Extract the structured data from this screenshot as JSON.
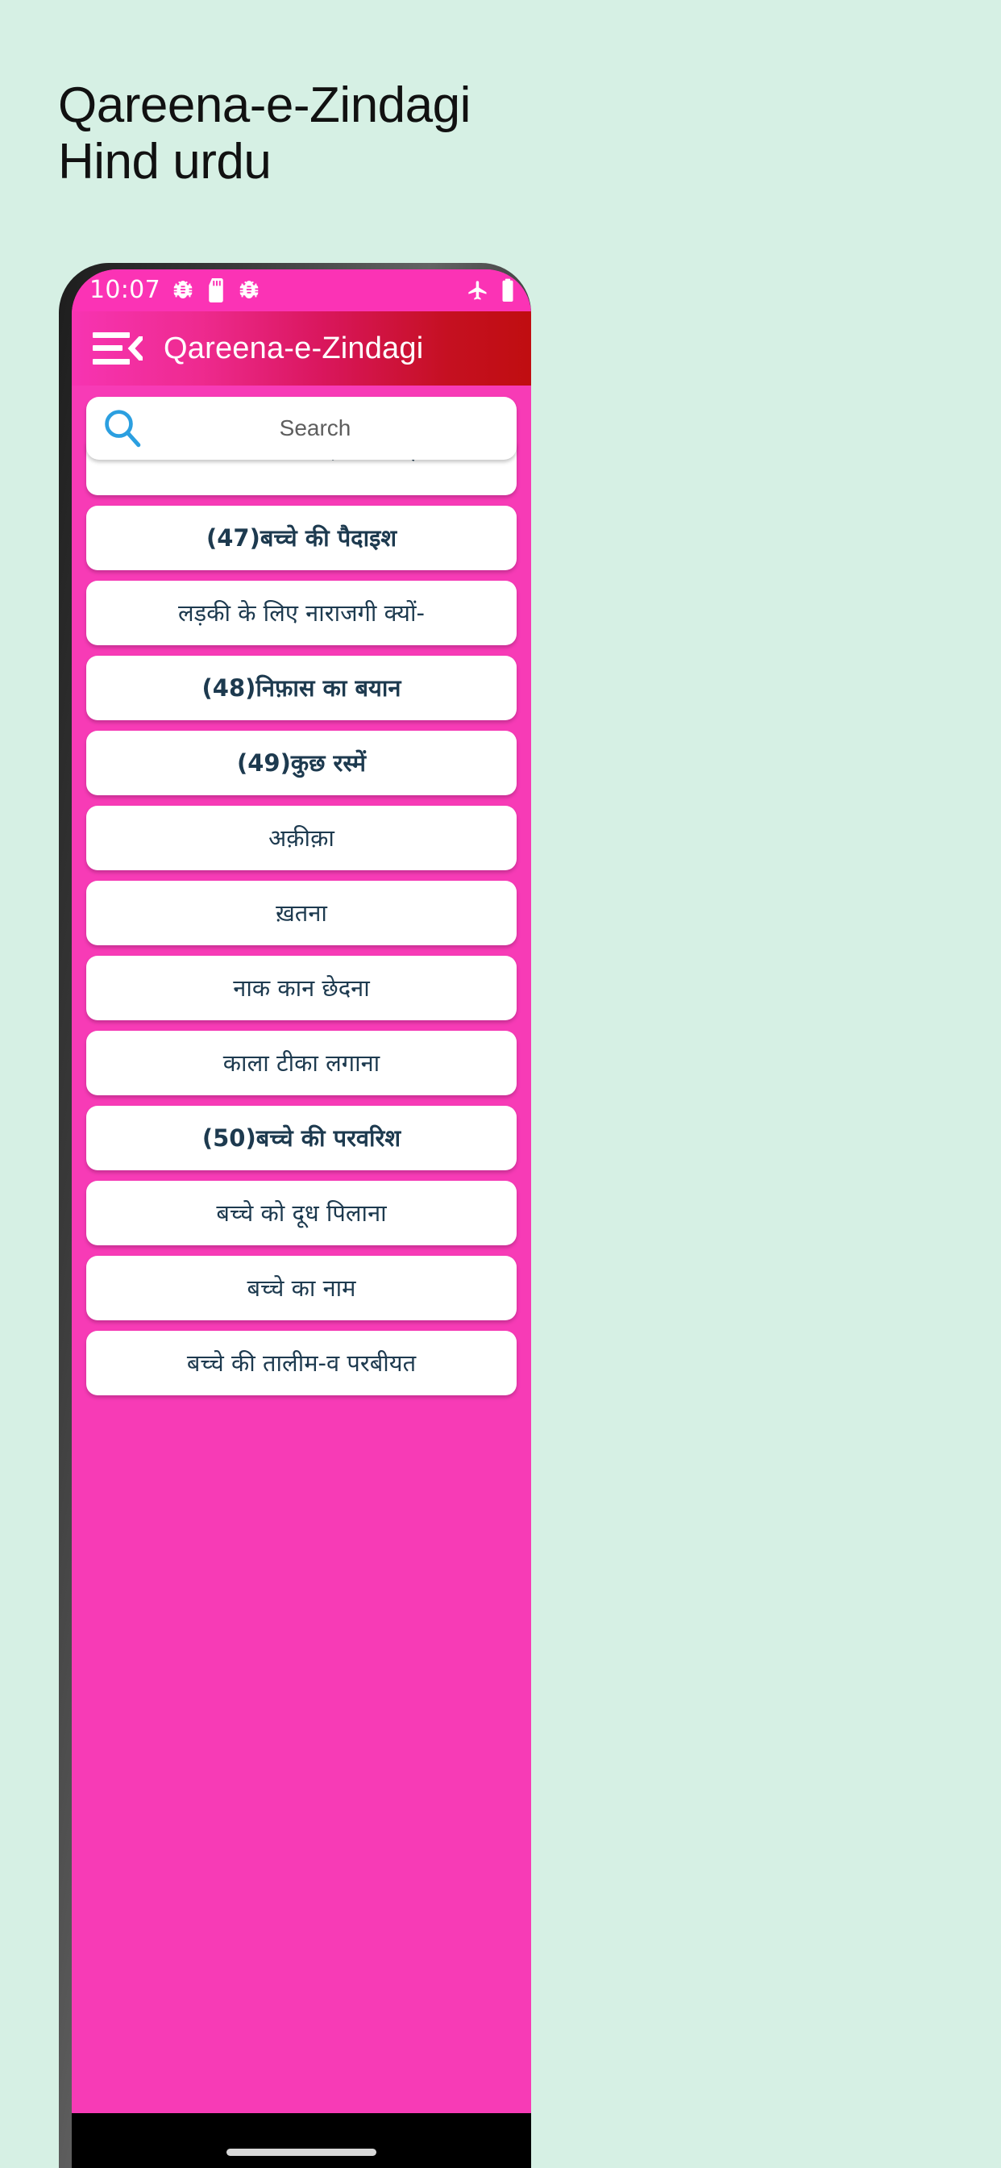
{
  "headline": "Qareena-e-Zindagi\nHind urdu",
  "statusbar": {
    "time": "10:07",
    "icons": [
      "bug-icon",
      "sd-card-icon",
      "bug-icon"
    ],
    "right_icons": [
      "airplane-mode-icon",
      "battery-icon"
    ]
  },
  "appbar": {
    "menu_icon": "hamburger-back-icon",
    "title": "Qareena-e-Zindagi"
  },
  "search": {
    "icon": "search-icon",
    "placeholder": "Search",
    "value": ""
  },
  "list": {
    "items": [
      {
        "label": "आसानी से विलादत के लिए",
        "bold": false,
        "partial": true
      },
      {
        "label": "(47)बच्चे की पैदाइश",
        "bold": true
      },
      {
        "label": "लड़की के लिए नाराजगी क्यों-",
        "bold": false
      },
      {
        "label": "(48)निफ़ास का बयान",
        "bold": true
      },
      {
        "label": "(49)कुछ रस्में",
        "bold": true
      },
      {
        "label": "अक़ीक़ा",
        "bold": false
      },
      {
        "label": "ख़तना",
        "bold": false
      },
      {
        "label": "नाक कान छेदना",
        "bold": false
      },
      {
        "label": "काला टीका लगाना",
        "bold": false
      },
      {
        "label": "(50)बच्चे की परवरिश",
        "bold": true
      },
      {
        "label": "बच्चे को दूध पिलाना",
        "bold": false
      },
      {
        "label": "बच्चे का नाम",
        "bold": false
      },
      {
        "label": "बच्चे की तालीम-व परबीयत",
        "bold": false
      }
    ]
  },
  "colors": {
    "page_background": "#d6f0e4",
    "status_pink": "#fb33b5",
    "body_pink": "#f73bb6",
    "appbar_gradient_start": "#f734b2",
    "appbar_gradient_end": "#c00d10",
    "card_text": "#1d3a4f",
    "search_icon": "#2b9fe0",
    "nav_black": "#000000"
  },
  "navbar": {
    "pill": "home-indicator"
  }
}
